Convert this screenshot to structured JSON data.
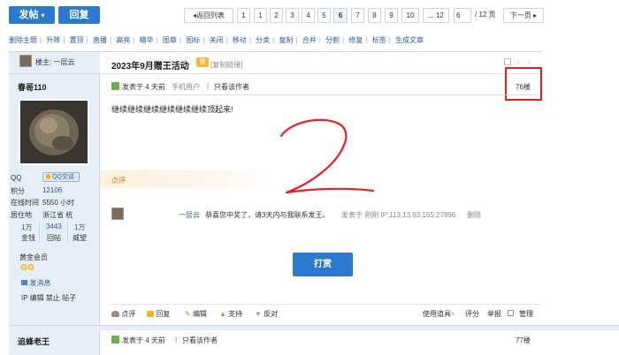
{
  "toolbar": {
    "post_label": "发帖",
    "post_arrow": "▾",
    "reply_label": "回复"
  },
  "pagination": {
    "back_label": "返回列表",
    "pages": [
      "1",
      "2",
      "3",
      "4",
      "5",
      "6",
      "7",
      "8",
      "9",
      "10",
      "... 12"
    ],
    "current": "6",
    "page_input": "6",
    "total": "/ 12 页",
    "next_label": "下一页"
  },
  "mod_actions": [
    "删除主题",
    "升降",
    "置顶",
    "直播",
    "高亮",
    "精华",
    "图章",
    "图标",
    "关闭",
    "移动",
    "分类",
    "复制",
    "合并",
    "分割",
    "修复",
    "标签",
    "生成文章"
  ],
  "thread": {
    "title": "2023年9月赠王活动",
    "badge": "赠",
    "copy_link": "[复制链接]"
  },
  "post1": {
    "floor_host_label": "楼主: 一层云",
    "username": "春哥110",
    "posted": "发表于 4 天前",
    "device": "手机用户",
    "only_author": "只看该作者",
    "floor": "76楼",
    "content": "继续继续继续继续继续继续顶起来!",
    "rating_label": "点评",
    "comment": {
      "user": "一层云",
      "text": "恭喜您中奖了，请3天内与我联系发王。",
      "meta": "发表于 刚刚 IP:113.13.93.155:27896",
      "delete": "删除"
    },
    "tip_button": "打赏",
    "footer": {
      "rate": "点评",
      "reply": "回复",
      "edit": "编辑",
      "support": "支持",
      "oppose": "反对",
      "tools": "使用道具",
      "score": "评分",
      "report": "举报",
      "manage": "管理"
    }
  },
  "profile": {
    "qq_label": "QQ",
    "qq_badge": "QQ交谈",
    "points_label": "积分",
    "points": "12106",
    "online_label": "在线时间",
    "online": "5550 小时",
    "location_label": "居住地",
    "location": "浙江省 杭",
    "stats": [
      {
        "v": "1万",
        "l": "金钱"
      },
      {
        "v": "3443",
        "l": "回帖"
      },
      {
        "v": "1万",
        "l": "威望"
      }
    ],
    "group": "黄金会员",
    "send_msg": "发消息",
    "ip_line": "IP 编辑 禁止 帖子"
  },
  "post2": {
    "username": "追蜂老王",
    "posted": "发表于 4 天前",
    "only_author": "只看该作者",
    "floor": "77楼"
  },
  "colors": {
    "accent": "#2b7acd",
    "highlight_box": "#e02020",
    "scribble": "#e8202a"
  }
}
